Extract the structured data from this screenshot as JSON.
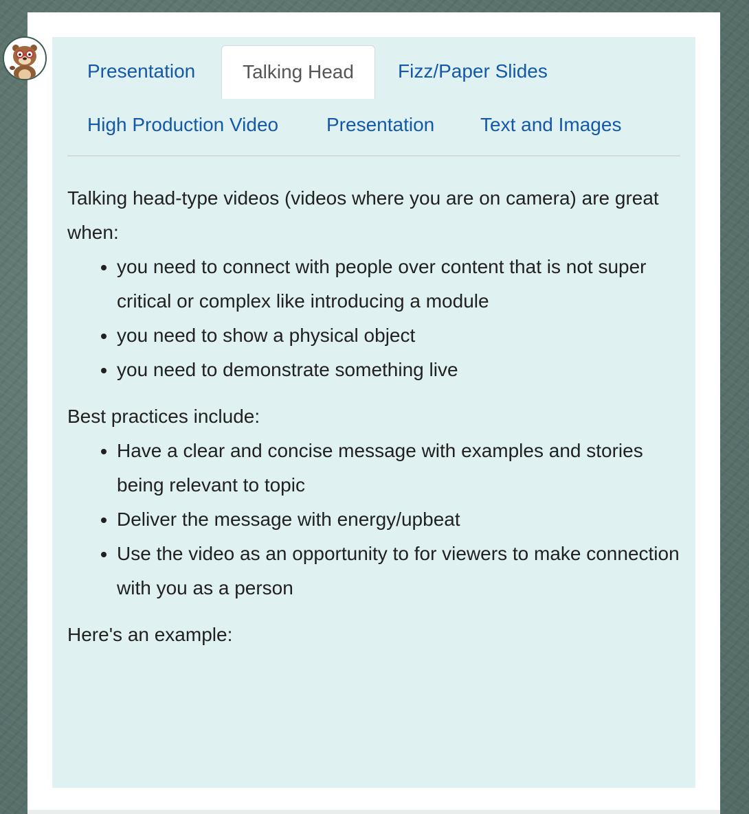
{
  "tabs": [
    {
      "label": "Presentation",
      "active": false
    },
    {
      "label": "Talking Head",
      "active": true
    },
    {
      "label": "Fizz/Paper Slides",
      "active": false
    },
    {
      "label": "High Production Video",
      "active": false
    },
    {
      "label": "Presentation",
      "active": false
    },
    {
      "label": "Text and Images",
      "active": false
    }
  ],
  "content": {
    "intro": "Talking head-type videos (videos where you are on camera) are great when:",
    "when_items": [
      "you need to connect with people over content that is not super critical or complex like introducing a module",
      "you need to show a physical object",
      "you need to demonstrate something live"
    ],
    "best_practices_heading": "Best practices include:",
    "best_practices": [
      "Have a clear and concise message with examples and stories being relevant to topic",
      "Deliver the message with energy/upbeat",
      "Use the video as an opportunity to for viewers to make connection with you as a person"
    ],
    "example_label": "Here's an example:"
  },
  "colors": {
    "panel_bg": "#e0f1f1",
    "tab_link": "#1458a8",
    "tab_active_text": "#555555",
    "body_text": "#212121"
  },
  "icons": {
    "avatar": "otter-with-glasses-icon"
  }
}
